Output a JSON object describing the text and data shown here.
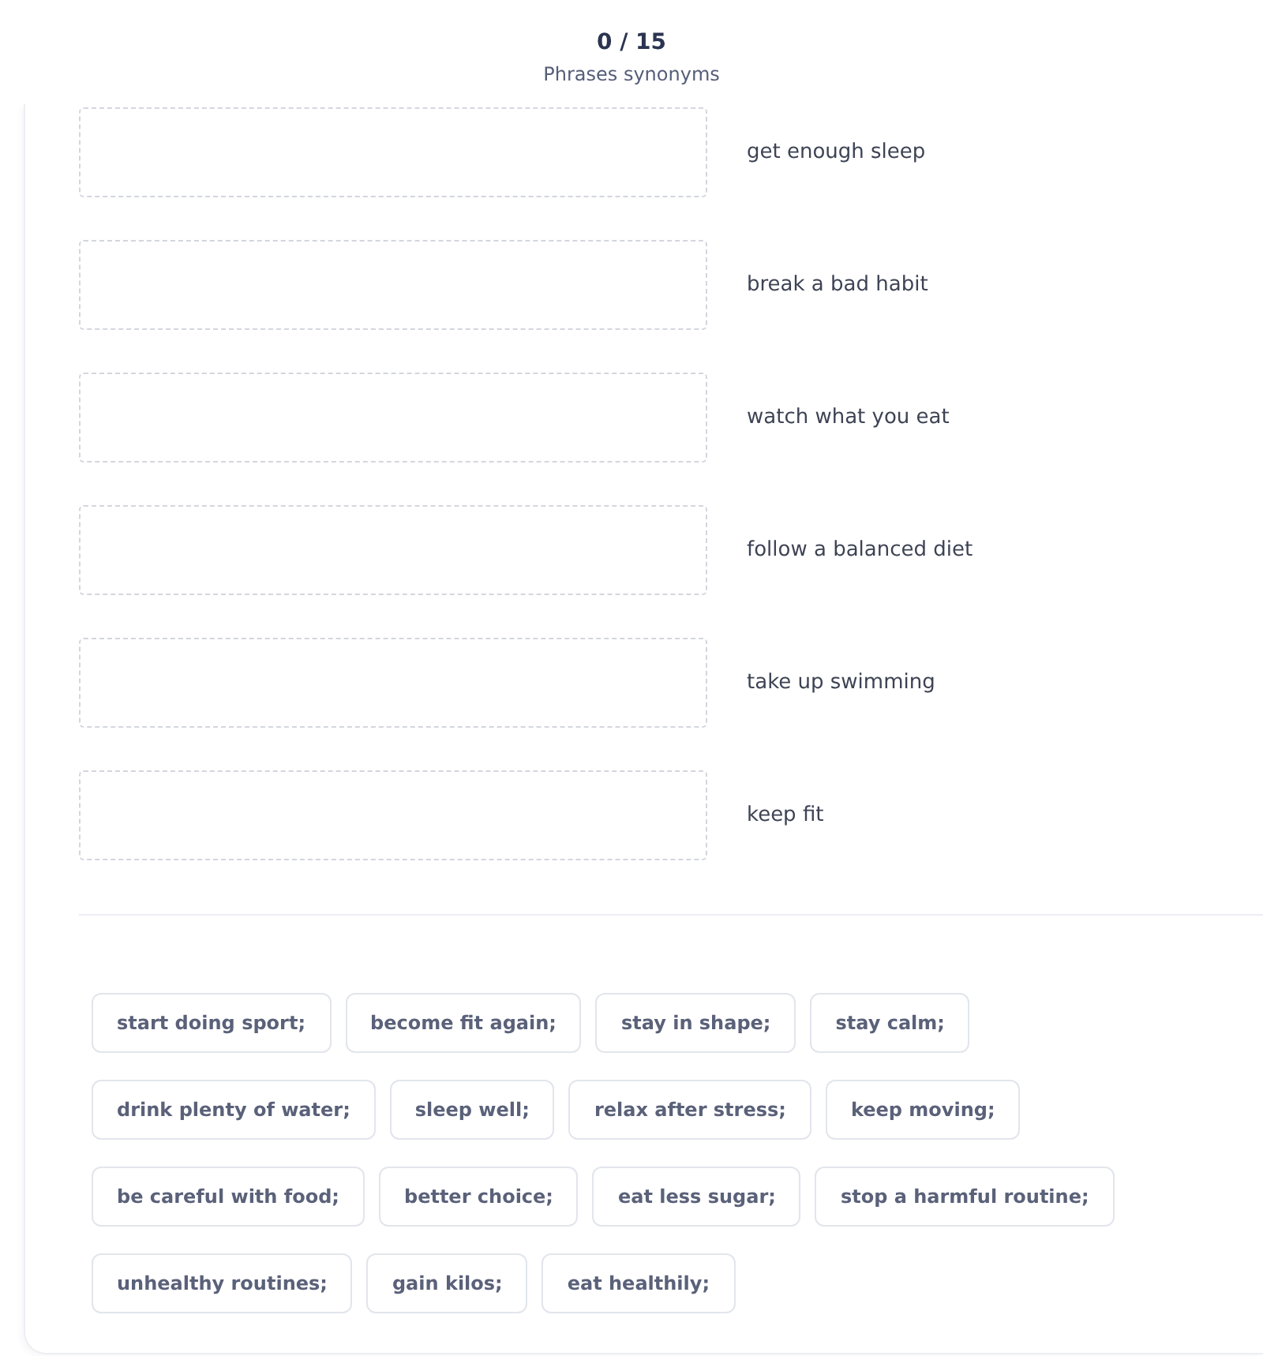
{
  "header": {
    "progress": "0 / 15",
    "title": "Phrases synonyms"
  },
  "pairs": [
    {
      "phrase": "get enough sleep"
    },
    {
      "phrase": "break a bad habit"
    },
    {
      "phrase": "watch what you eat"
    },
    {
      "phrase": "follow a balanced diet"
    },
    {
      "phrase": "take up swimming"
    },
    {
      "phrase": "keep fit"
    }
  ],
  "word_bank": {
    "rows": [
      [
        "start doing sport;",
        "become fit again;",
        "stay in shape;",
        "stay calm;"
      ],
      [
        "drink plenty of water;",
        "sleep well;",
        "relax after stress;",
        "keep moving;"
      ],
      [
        "be careful with food;",
        "better choice;",
        "eat less sugar;",
        "stop a harmful routine;"
      ],
      [
        "unhealthy routines;",
        "gain kilos;",
        "eat healthily;"
      ]
    ]
  }
}
